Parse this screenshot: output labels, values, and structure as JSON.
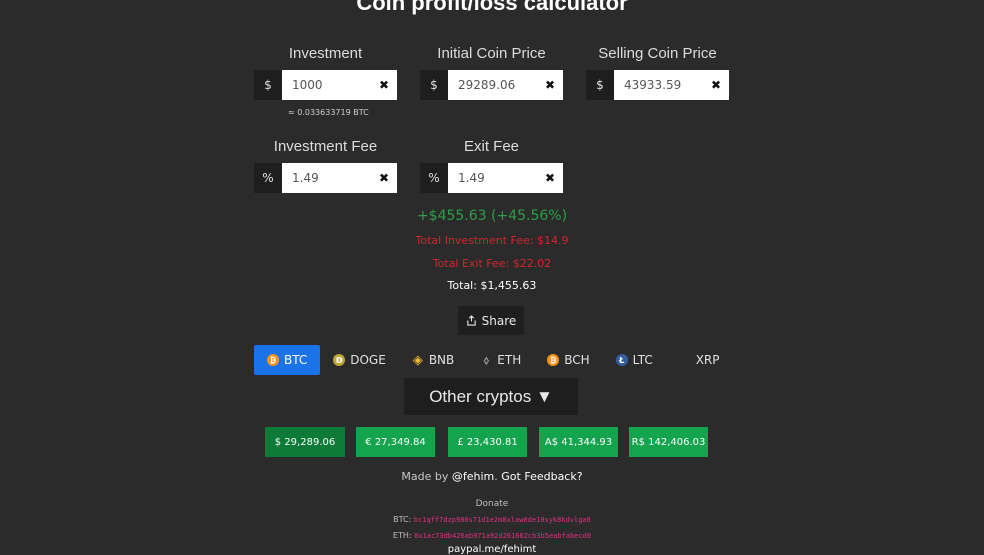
{
  "page": {
    "title": "Coin profit/loss calculator"
  },
  "fields": {
    "investment": {
      "label": "Investment",
      "prefix": "$",
      "value": "1000"
    },
    "initial_price": {
      "label": "Initial Coin Price",
      "prefix": "$",
      "value": "29289.06"
    },
    "selling_price": {
      "label": "Selling Coin Price",
      "prefix": "$",
      "value": "43933.59"
    },
    "investment_fee": {
      "label": "Investment Fee",
      "prefix": "%",
      "value": "1.49"
    },
    "exit_fee": {
      "label": "Exit Fee",
      "prefix": "%",
      "value": "1.49"
    },
    "approx": "≈ 0.033633719 BTC"
  },
  "results": {
    "profit": "+$455.63 (+45.56%)",
    "total_investment_fee": "Total Investment Fee: $14.9",
    "total_exit_fee": "Total Exit Fee: $22.02",
    "total": "Total: $1,455.63",
    "profit_color": "#2e9e47",
    "fee_color": "#d0262e"
  },
  "share": {
    "label": "Share"
  },
  "coins": [
    {
      "label": "BTC",
      "icon": "btc-icon",
      "active": true
    },
    {
      "label": "DOGE",
      "icon": "doge-icon"
    },
    {
      "label": "BNB",
      "icon": "bnb-icon"
    },
    {
      "label": "ETH",
      "icon": "eth-icon"
    },
    {
      "label": "BCH",
      "icon": "bch-icon"
    },
    {
      "label": "LTC",
      "icon": "ltc-icon"
    },
    {
      "label": "XRP",
      "icon": "xrp-icon"
    }
  ],
  "other_cryptos": {
    "label": "Other cryptos ▼"
  },
  "prices": [
    {
      "label": "$ 29,289.06",
      "active": true
    },
    {
      "label": "€ 27,349.84"
    },
    {
      "label": "£ 23,430.81"
    },
    {
      "label": "A$ 41,344.93"
    },
    {
      "label": "R$ 142,406.03"
    }
  ],
  "footer": {
    "made_by": "Made by",
    "author": "@fehim",
    "feedback": "Got Feedback?",
    "donate": "Donate",
    "btc_label": "BTC:",
    "btc_address": "bc1qff7dzp980s71d1e2m8xlaw0de10syk8kdvlga8",
    "eth_label": "ETH:",
    "eth_address": "0x1ac73db426ab971a92d261662cb3b5eabfabecd0",
    "paypal": "paypal.me/fehimt"
  },
  "colors": {
    "accent": "#1a73e8",
    "price_button": "#14a44d",
    "background": "#2b2b2b"
  }
}
